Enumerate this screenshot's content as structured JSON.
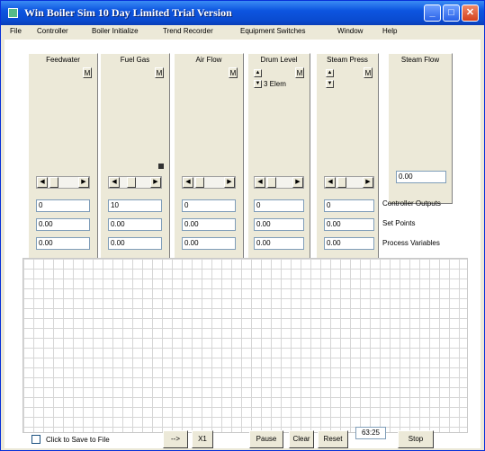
{
  "window": {
    "title": "Win Boiler Sim 10 Day Limited Trial Version"
  },
  "titlebar_buttons": {
    "minimize": "_",
    "maximize": "□",
    "close": "✕"
  },
  "menu": [
    "File",
    "Controller",
    "Boiler Initialize",
    "Trend Recorder",
    "Equipment Switches",
    "Window",
    "Help"
  ],
  "panels": [
    {
      "title": "Feedwater",
      "mode": "M",
      "co": "0",
      "sp": "0.00",
      "pv": "0.00"
    },
    {
      "title": "Fuel Gas",
      "mode": "M",
      "co": "10",
      "sp": "0.00",
      "pv": "0.00"
    },
    {
      "title": "Air Flow",
      "mode": "M",
      "co": "0",
      "sp": "0.00",
      "pv": "0.00"
    },
    {
      "title": "Drum Level",
      "mode": "M",
      "co": "0",
      "sp": "0.00",
      "pv": "0.00",
      "elements": "3 Elem"
    },
    {
      "title": "Steam Press",
      "mode": "M",
      "co": "0",
      "sp": "0.00",
      "pv": "0.00"
    }
  ],
  "steam_flow": {
    "title": "Steam Flow",
    "value": "0.00"
  },
  "row_labels": {
    "co": "Controller Outputs",
    "sp": "Set Points",
    "pv": "Process Variables"
  },
  "bottom": {
    "save_label": "Click to Save to File",
    "arrow_label": "-->",
    "scale_label": "X1",
    "pause_label": "Pause",
    "clear_label": "Clear",
    "reset_label": "Reset",
    "time": "63:25",
    "stop_label": "Stop"
  }
}
